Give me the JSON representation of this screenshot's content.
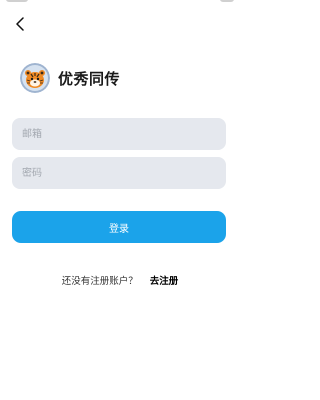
{
  "header": {
    "back_icon": "chevron-left-icon"
  },
  "brand": {
    "logo_icon": "tiger-logo-icon",
    "name": "优秀同传"
  },
  "form": {
    "email_placeholder": "邮箱",
    "email_value": "",
    "password_placeholder": "密码",
    "password_value": "",
    "login_label": "登录"
  },
  "footer": {
    "no_account_text": "还没有注册账户？",
    "register_label": "去注册"
  },
  "colors": {
    "accent": "#1ba3ea",
    "field_background": "#e5e8ee",
    "background": "#ffffff"
  }
}
